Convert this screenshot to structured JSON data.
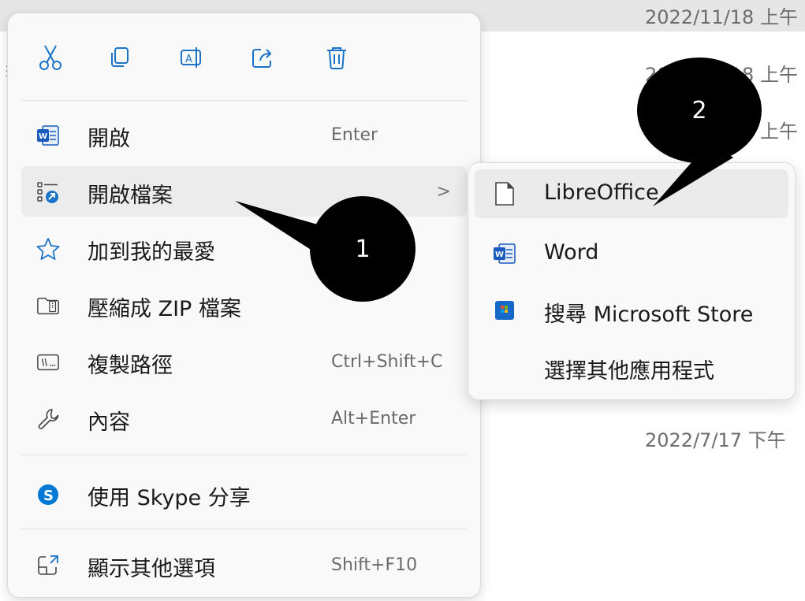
{
  "background": {
    "dates": [
      "2022/11/18 上午",
      "2022/11/18 上午",
      "2022/11/18 上午",
      "2022/7/17 下午"
    ]
  },
  "toolbar": {
    "icons": [
      "cut-icon",
      "copy-icon",
      "rename-icon",
      "share-icon",
      "delete-icon"
    ]
  },
  "menu": {
    "items": [
      {
        "label": "開啟",
        "shortcut": "Enter",
        "icon": "word-icon"
      },
      {
        "label": "開啟檔案",
        "shortcut": "",
        "icon": "open-with-icon"
      },
      {
        "label": "加到我的最愛",
        "shortcut": "",
        "icon": "star-icon"
      },
      {
        "label": "壓縮成 ZIP 檔案",
        "shortcut": "",
        "icon": "zip-icon"
      },
      {
        "label": "複製路徑",
        "shortcut": "Ctrl+Shift+C",
        "icon": "copy-path-icon"
      },
      {
        "label": "內容",
        "shortcut": "Alt+Enter",
        "icon": "wrench-icon"
      },
      {
        "label": "使用 Skype 分享",
        "shortcut": "",
        "icon": "skype-icon"
      },
      {
        "label": "顯示其他選項",
        "shortcut": "Shift+F10",
        "icon": "more-options-icon"
      }
    ],
    "submenu_arrow": ">"
  },
  "submenu": {
    "items": [
      {
        "label": "LibreOffice",
        "icon": "document-icon"
      },
      {
        "label": "Word",
        "icon": "word-icon"
      },
      {
        "label": "搜尋 Microsoft Store",
        "icon": "store-icon"
      },
      {
        "label": "選擇其他應用程式",
        "icon": ""
      }
    ]
  },
  "callouts": {
    "one": "1",
    "two": "2"
  },
  "colors": {
    "word": "#185abd",
    "skype": "#0078d4",
    "accent": "#0067c0"
  }
}
